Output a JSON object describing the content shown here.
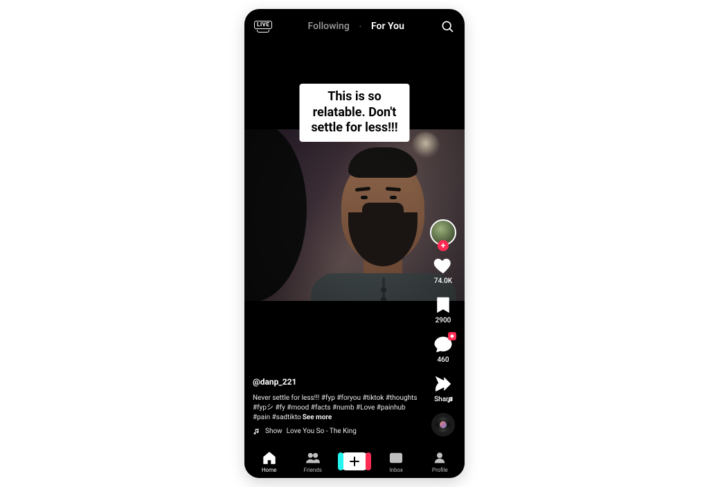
{
  "topbar": {
    "live_label": "LIVE",
    "tab_following": "Following",
    "tab_for_you": "For You"
  },
  "caption_overlay": "This is so relatable. Don't settle for less!!!",
  "rail": {
    "likes": "74.0K",
    "bookmarks": "2900",
    "comments": "460",
    "share_label": "Share"
  },
  "meta": {
    "username": "@danp_221",
    "description": "Never settle for less!!! #fyp #foryou #tiktok #thoughts #fypシ #fy #mood #facts #numb #Love #painhub #pain #sadtikto",
    "see_more": "See more",
    "sound_prefix": "Show",
    "sound_title": "Love You So - The King"
  },
  "nav": {
    "home": "Home",
    "friends": "Friends",
    "inbox": "Inbox",
    "profile": "Profile"
  }
}
